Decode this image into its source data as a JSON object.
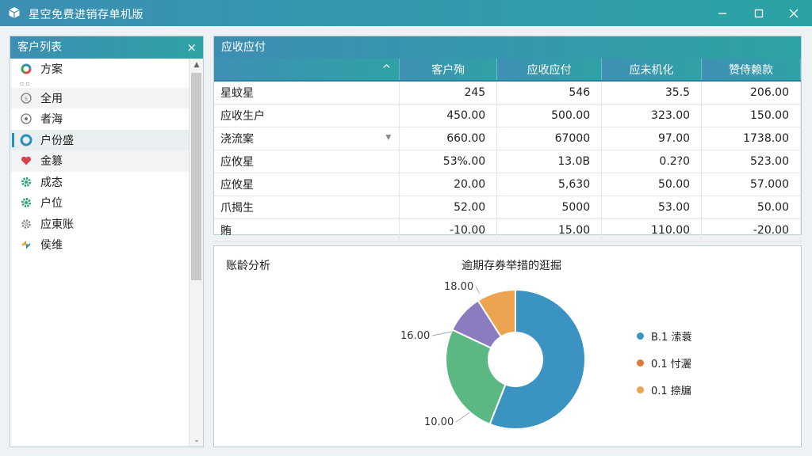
{
  "window": {
    "title": "星空免费进销存单机版",
    "controls": [
      "minimize",
      "maximize",
      "close"
    ]
  },
  "customer_panel": {
    "title": "客户列表",
    "close_label": "×",
    "items": [
      {
        "label": "方案",
        "icon": "chrome-ring-icon",
        "color": "#e8453c"
      },
      {
        "label": "",
        "icon": "separator",
        "color": "#999999"
      },
      {
        "label": "全用",
        "icon": "circle-s-icon",
        "color": "#777777"
      },
      {
        "label": "者海",
        "icon": "circle-outline-icon",
        "color": "#777777"
      },
      {
        "label": "户份盛",
        "icon": "blue-ring-icon",
        "color": "#2c8fc0"
      },
      {
        "label": "金篡",
        "icon": "heart-icon",
        "color": "#d9414b"
      },
      {
        "label": "成态",
        "icon": "gear-icon",
        "color": "#2ea37a"
      },
      {
        "label": "户位",
        "icon": "gear-icon",
        "color": "#2ea37a"
      },
      {
        "label": "应東账",
        "icon": "gear-outline-icon",
        "color": "#888888"
      },
      {
        "label": "侯维",
        "icon": "arrows-icon",
        "color": "#e8a23c"
      }
    ]
  },
  "receivables": {
    "title": "应收应付",
    "sort_indicator": "^",
    "columns": [
      "",
      "客户殉",
      "应收应付",
      "应未机化",
      "赞侍赖款"
    ],
    "rows": [
      {
        "name": "星蚊星",
        "v1": "245",
        "v2": "546",
        "v3": "35.5",
        "v4": "206.00",
        "dropdown": false
      },
      {
        "name": "应收生户",
        "v1": "450.00",
        "v2": "500.00",
        "v3": "323.00",
        "v4": "150.00",
        "dropdown": false
      },
      {
        "name": "浇流案",
        "v1": "660.00",
        "v2": "67000",
        "v3": "97.00",
        "v4": "1738.00",
        "dropdown": true
      },
      {
        "name": "应攸星",
        "v1": "53%.00",
        "v2": "13.0B",
        "v3": "0.2?0",
        "v4": "523.00",
        "dropdown": false
      },
      {
        "name": "应攸星",
        "v1": "20.00",
        "v2": "5,630",
        "v3": "50.00",
        "v4": "57.000",
        "dropdown": false
      },
      {
        "name": "爪揭生",
        "v1": "52.00",
        "v2": "5000",
        "v3": "53.00",
        "v4": "50.00",
        "dropdown": false
      },
      {
        "name": "賄",
        "v1": "-10.00",
        "v2": "15.00",
        "v3": "110.00",
        "v4": "-20.00",
        "dropdown": false
      }
    ]
  },
  "aging": {
    "section_title": "账龄分析",
    "chart_data": {
      "type": "pie",
      "title": "逾期存券举措的逛掘",
      "style": "donut",
      "slices": [
        {
          "label": "",
          "value": 56,
          "color": "#3b93c1"
        },
        {
          "label": "16.00",
          "value": 26,
          "color": "#5cb882"
        },
        {
          "label": "",
          "value": 9,
          "color": "#8b7cc0"
        },
        {
          "label": "18.00",
          "value": 9,
          "color": "#eda450"
        }
      ],
      "outer_labels": [
        "18.00",
        "16.00",
        "10.00"
      ],
      "legend": [
        {
          "label": "B.1 溹蓑",
          "color": "#3b93c1"
        },
        {
          "label": "0.1 忖灑",
          "color": "#e07a3a"
        },
        {
          "label": "0.1 捺牖",
          "color": "#eda450"
        }
      ],
      "legend_position": "right"
    }
  }
}
